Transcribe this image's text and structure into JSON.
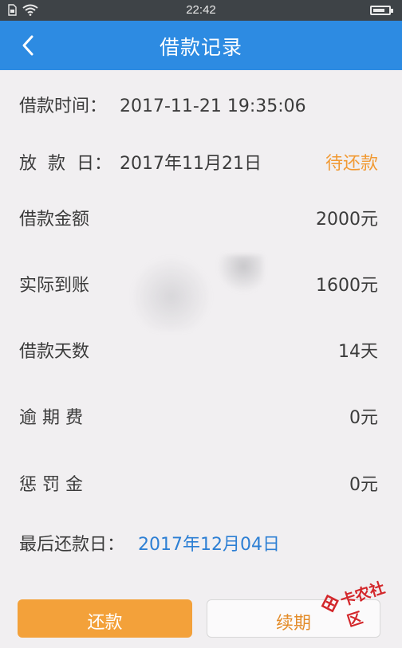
{
  "status_bar": {
    "time": "22:42"
  },
  "header": {
    "title": "借款记录"
  },
  "rows": {
    "borrow_time": {
      "label": "借款时间：",
      "value": "2017-11-21 19:35:06"
    },
    "disburse_day": {
      "label": "放  款  日：",
      "value": "2017年11月21日",
      "status": "待还款"
    },
    "loan_amount": {
      "label": "借款金额",
      "value": "2000元"
    },
    "actual_received": {
      "label": "实际到账",
      "value": "1600元"
    },
    "loan_days": {
      "label": "借款天数",
      "value": "14天"
    },
    "overdue_fee": {
      "label": "逾 期 费",
      "value": "0元"
    },
    "penalty": {
      "label": "惩 罚 金",
      "value": "0元"
    },
    "last_repay_day": {
      "label": "最后还款日：",
      "value": "2017年12月04日"
    }
  },
  "buttons": {
    "repay": "还款",
    "renew": "续期"
  },
  "watermark": {
    "text": "卡农社区"
  },
  "colors": {
    "header": "#2d8be2",
    "accent_orange": "#f3a13a",
    "link_blue": "#2d7fd4"
  }
}
